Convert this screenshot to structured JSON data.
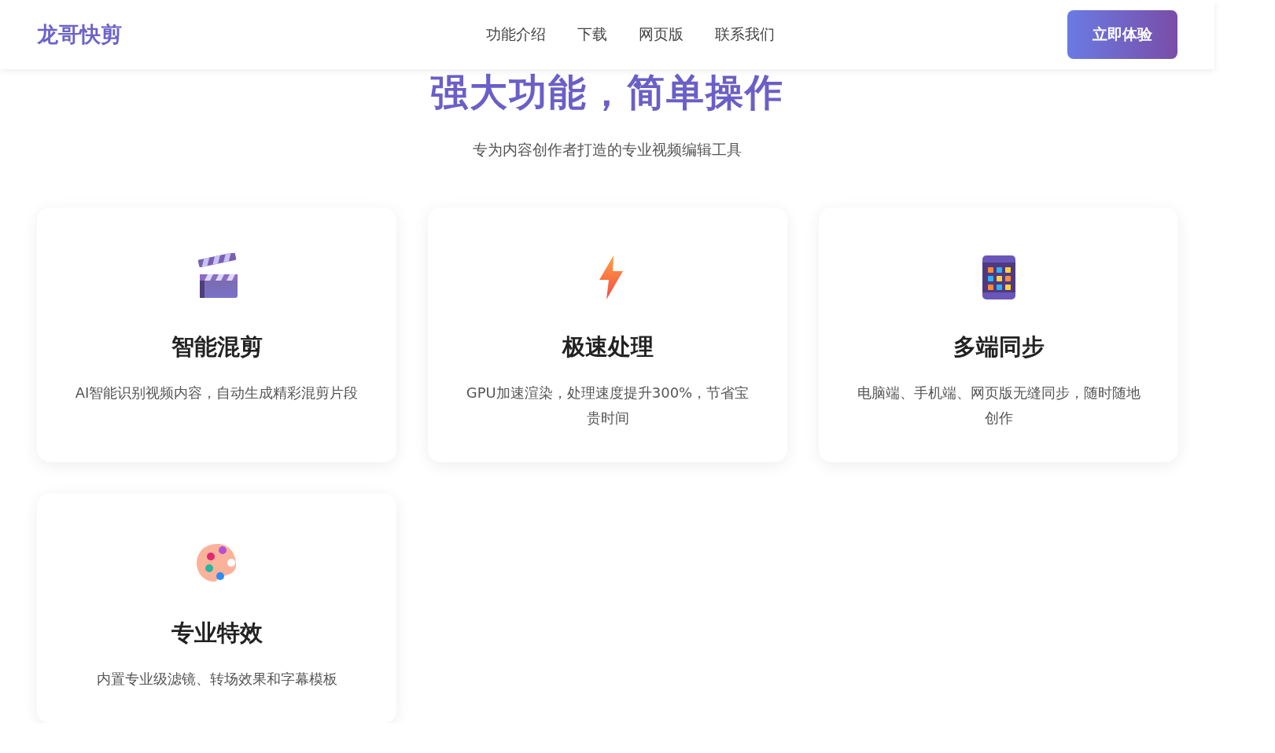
{
  "header": {
    "logo": "龙哥快剪",
    "nav": [
      "功能介绍",
      "下载",
      "网页版",
      "联系我们"
    ],
    "cta": "立即体验"
  },
  "section": {
    "title": "强大功能，简单操作",
    "subtitle": "专为内容创作者打造的专业视频编辑工具"
  },
  "features": [
    {
      "kind": "clapper",
      "title": "智能混剪",
      "text": "AI智能识别视频内容，自动生成精彩混剪片段"
    },
    {
      "kind": "bolt",
      "title": "极速处理",
      "text": "GPU加速渲染，处理速度提升300%，节省宝贵时间"
    },
    {
      "kind": "tablet",
      "title": "多端同步",
      "text": "电脑端、手机端、网页版无缝同步，随时随地创作"
    },
    {
      "kind": "palette",
      "title": "专业特效",
      "text": "内置专业级滤镜、转场效果和字幕模板"
    }
  ]
}
